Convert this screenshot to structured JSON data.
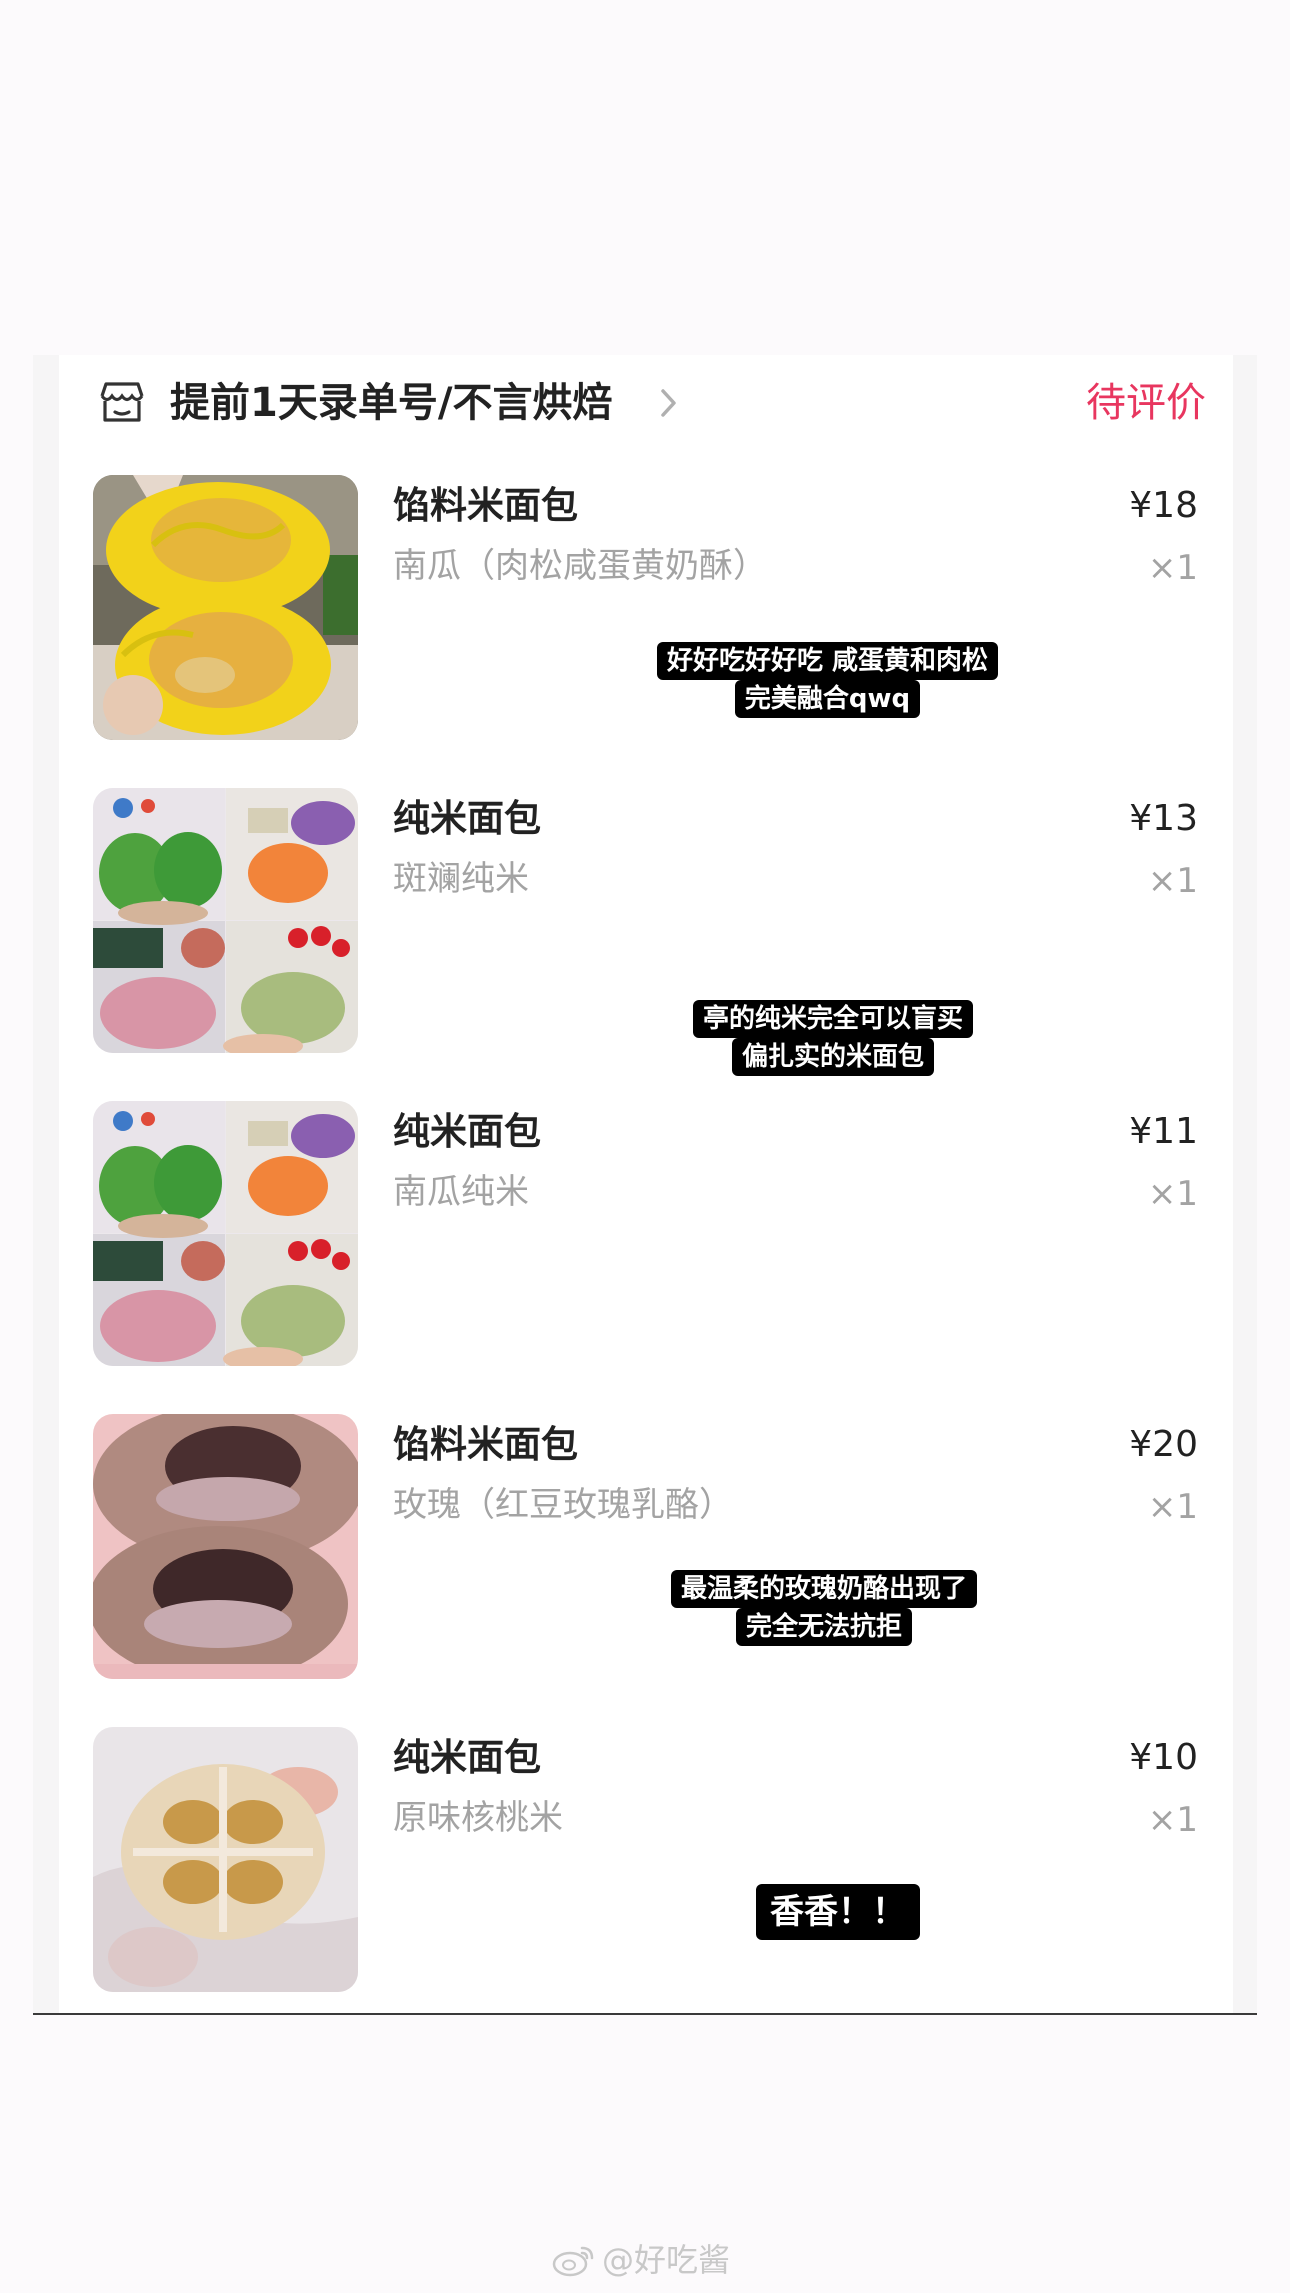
{
  "shop": {
    "name": "提前1天录单号/不言烘焙",
    "status": "待评价"
  },
  "items": [
    {
      "title": "馅料米面包",
      "variant": "南瓜（肉松咸蛋黄奶酥）",
      "price": "¥18",
      "qty": "×1",
      "caption": [
        "好好吃好好吃 咸蛋黄和肉松",
        "完美融合qwq"
      ],
      "thumb": "pumpkin-bread-photo"
    },
    {
      "title": "纯米面包",
      "variant": "斑斓纯米",
      "price": "¥13",
      "qty": "×1",
      "caption": [
        "亭的纯米完全可以盲买",
        "偏扎实的米面包"
      ],
      "thumb": "rice-bread-collage-photo"
    },
    {
      "title": "纯米面包",
      "variant": "南瓜纯米",
      "price": "¥11",
      "qty": "×1",
      "caption": [],
      "thumb": "rice-bread-collage-photo"
    },
    {
      "title": "馅料米面包",
      "variant": "玫瑰（红豆玫瑰乳酪）",
      "price": "¥20",
      "qty": "×1",
      "caption": [
        "最温柔的玫瑰奶酪出现了",
        "完全无法抗拒"
      ],
      "thumb": "rose-bread-photo"
    },
    {
      "title": "纯米面包",
      "variant": "原味核桃米",
      "price": "¥10",
      "qty": "×1",
      "caption": [
        "香香！！"
      ],
      "thumb": "walnut-bread-photo"
    }
  ],
  "watermark": {
    "text": "@好吃酱",
    "icon": "weibo-icon"
  },
  "colors": {
    "status": "#e8365f",
    "variant_text": "#a3a3a3",
    "caption_bg": "#000000"
  }
}
